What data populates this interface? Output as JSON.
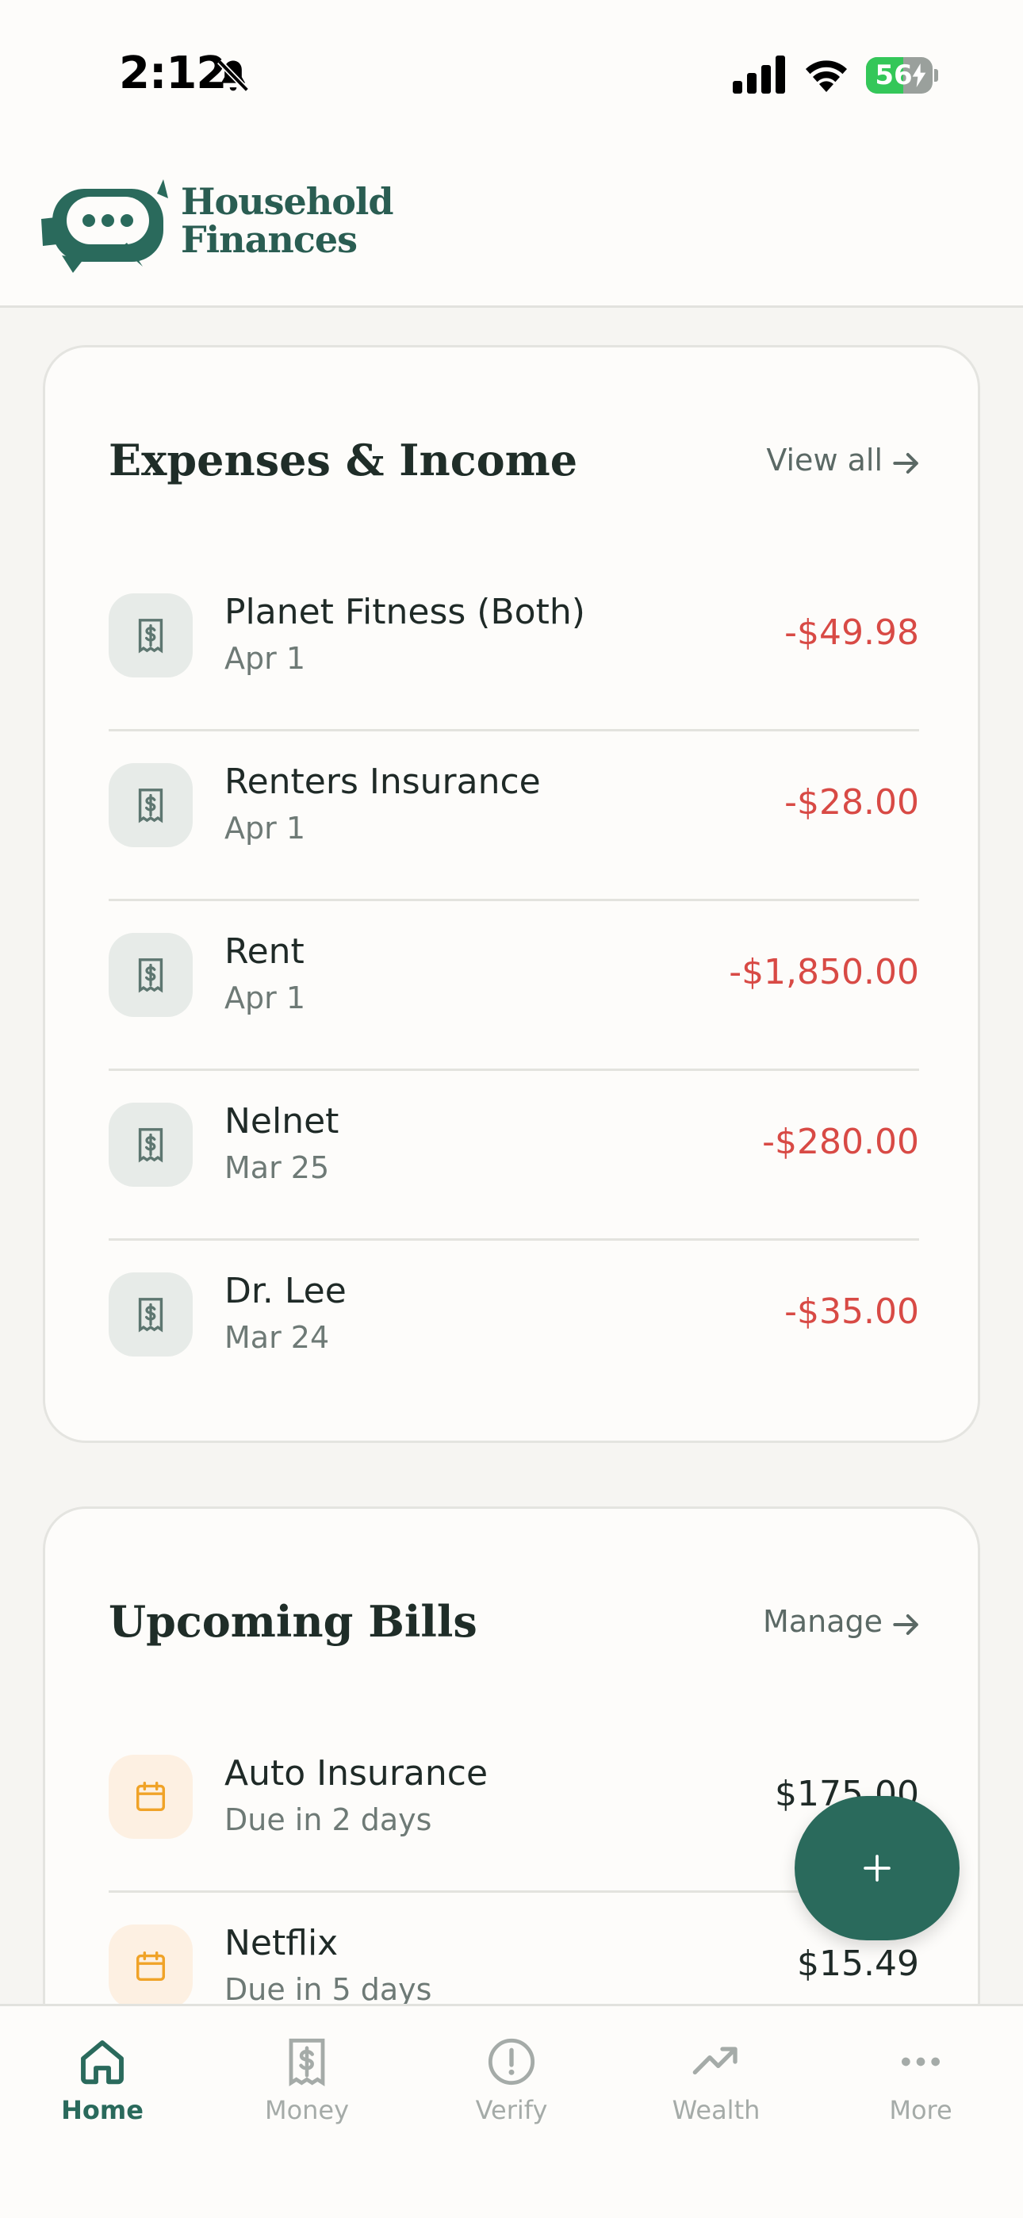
{
  "status_bar": {
    "time": "2:12",
    "battery": "56",
    "battery_level": 0.56,
    "icons": [
      "bell-slash-icon",
      "cellular-signal-icon",
      "wifi-icon",
      "battery-charging-icon"
    ]
  },
  "header": {
    "logo_line1": "Household",
    "logo_line2": "Finances"
  },
  "expenses": {
    "title": "Expenses & Income",
    "view_all": "View all",
    "items": [
      {
        "name": "Planet Fitness (Both)",
        "date": "Apr 1",
        "amount": "-$49.98"
      },
      {
        "name": "Renters Insurance",
        "date": "Apr 1",
        "amount": "-$28.00"
      },
      {
        "name": "Rent",
        "date": "Apr 1",
        "amount": "-$1,850.00"
      },
      {
        "name": "Nelnet",
        "date": "Mar 25",
        "amount": "-$280.00"
      },
      {
        "name": "Dr. Lee",
        "date": "Mar 24",
        "amount": "-$35.00"
      }
    ]
  },
  "bills": {
    "title": "Upcoming Bills",
    "manage": "Manage",
    "items": [
      {
        "name": "Auto Insurance",
        "due": "Due in 2 days",
        "amount": "$175.00"
      },
      {
        "name": "Netflix",
        "due": "Due in 5 days",
        "amount": "$15.49"
      }
    ]
  },
  "fab": {
    "label": "+"
  },
  "tabs": [
    {
      "label": "Home",
      "icon": "home-icon",
      "active": true
    },
    {
      "label": "Money",
      "icon": "receipt-dollar-icon",
      "active": false
    },
    {
      "label": "Verify",
      "icon": "alert-circle-icon",
      "active": false
    },
    {
      "label": "Wealth",
      "icon": "trending-up-icon",
      "active": false
    },
    {
      "label": "More",
      "icon": "more-dots-icon",
      "active": false
    }
  ],
  "colors": {
    "brand": "#2a6a5c",
    "negative": "#d84a45",
    "bill_accent": "#f0a328",
    "battery_green": "#34c759"
  }
}
